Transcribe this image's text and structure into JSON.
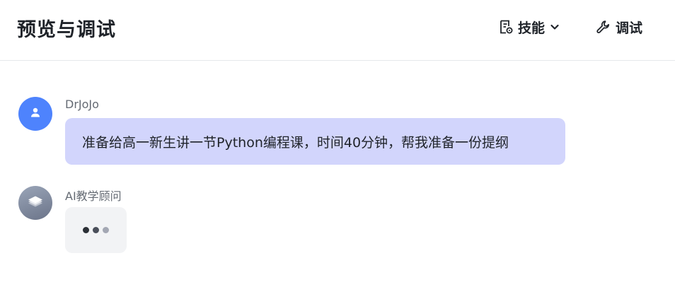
{
  "header": {
    "title": "预览与调试",
    "skills_label": "技能",
    "debug_label": "调试"
  },
  "messages": [
    {
      "role": "user",
      "sender": "DrJoJo",
      "text": "准备给高一新生讲一节Python编程课，时间40分钟，帮我准备一份提纲",
      "avatar_icon": "user-icon"
    },
    {
      "role": "assistant",
      "sender": "AI教学顾问",
      "status": "typing",
      "avatar_icon": "layers-icon"
    }
  ],
  "colors": {
    "user_avatar": "#4e83fd",
    "user_bubble": "#d2d5fc",
    "bot_bubble": "#f2f3f5",
    "typing_dots": [
      "#2b2f36",
      "#4a4f5a",
      "#a3a7b3"
    ]
  }
}
